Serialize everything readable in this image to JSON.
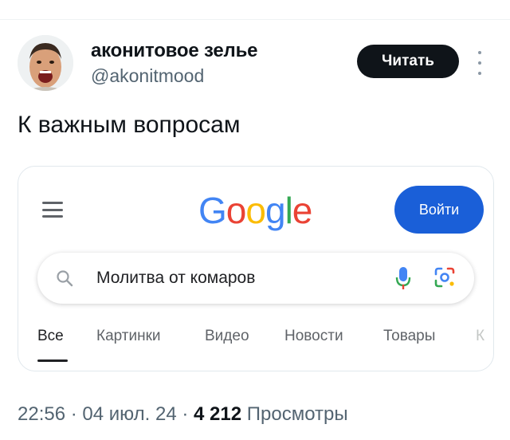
{
  "author": {
    "name": "аконитовое зелье",
    "handle": "@akonitmood"
  },
  "follow_label": "Читать",
  "more_icon": "more-vertical-icon",
  "tweet_text": "К важным вопросам",
  "card": {
    "menu_icon": "hamburger-menu-icon",
    "logo_letters": [
      {
        "ch": "G",
        "color": "#4285f4"
      },
      {
        "ch": "o",
        "color": "#ea4335"
      },
      {
        "ch": "o",
        "color": "#fbbc05"
      },
      {
        "ch": "g",
        "color": "#4285f4"
      },
      {
        "ch": "l",
        "color": "#34a853"
      },
      {
        "ch": "e",
        "color": "#ea4335"
      }
    ],
    "signin_label": "Войти",
    "search": {
      "query": "Молитва от комаров",
      "search_icon": "search-icon",
      "mic_icon": "microphone-icon",
      "lens_icon": "camera-lens-icon"
    },
    "tabs": [
      "Все",
      "Картинки",
      "Видео",
      "Новости",
      "Товары",
      "К"
    ],
    "active_tab": "Все"
  },
  "meta": {
    "time": "22:56",
    "date": "04 июл. 24",
    "views_count": "4 212",
    "views_label": "Просмотры"
  },
  "colors": {
    "accent": "#1a5fd8",
    "follow_bg": "#0f1419"
  }
}
